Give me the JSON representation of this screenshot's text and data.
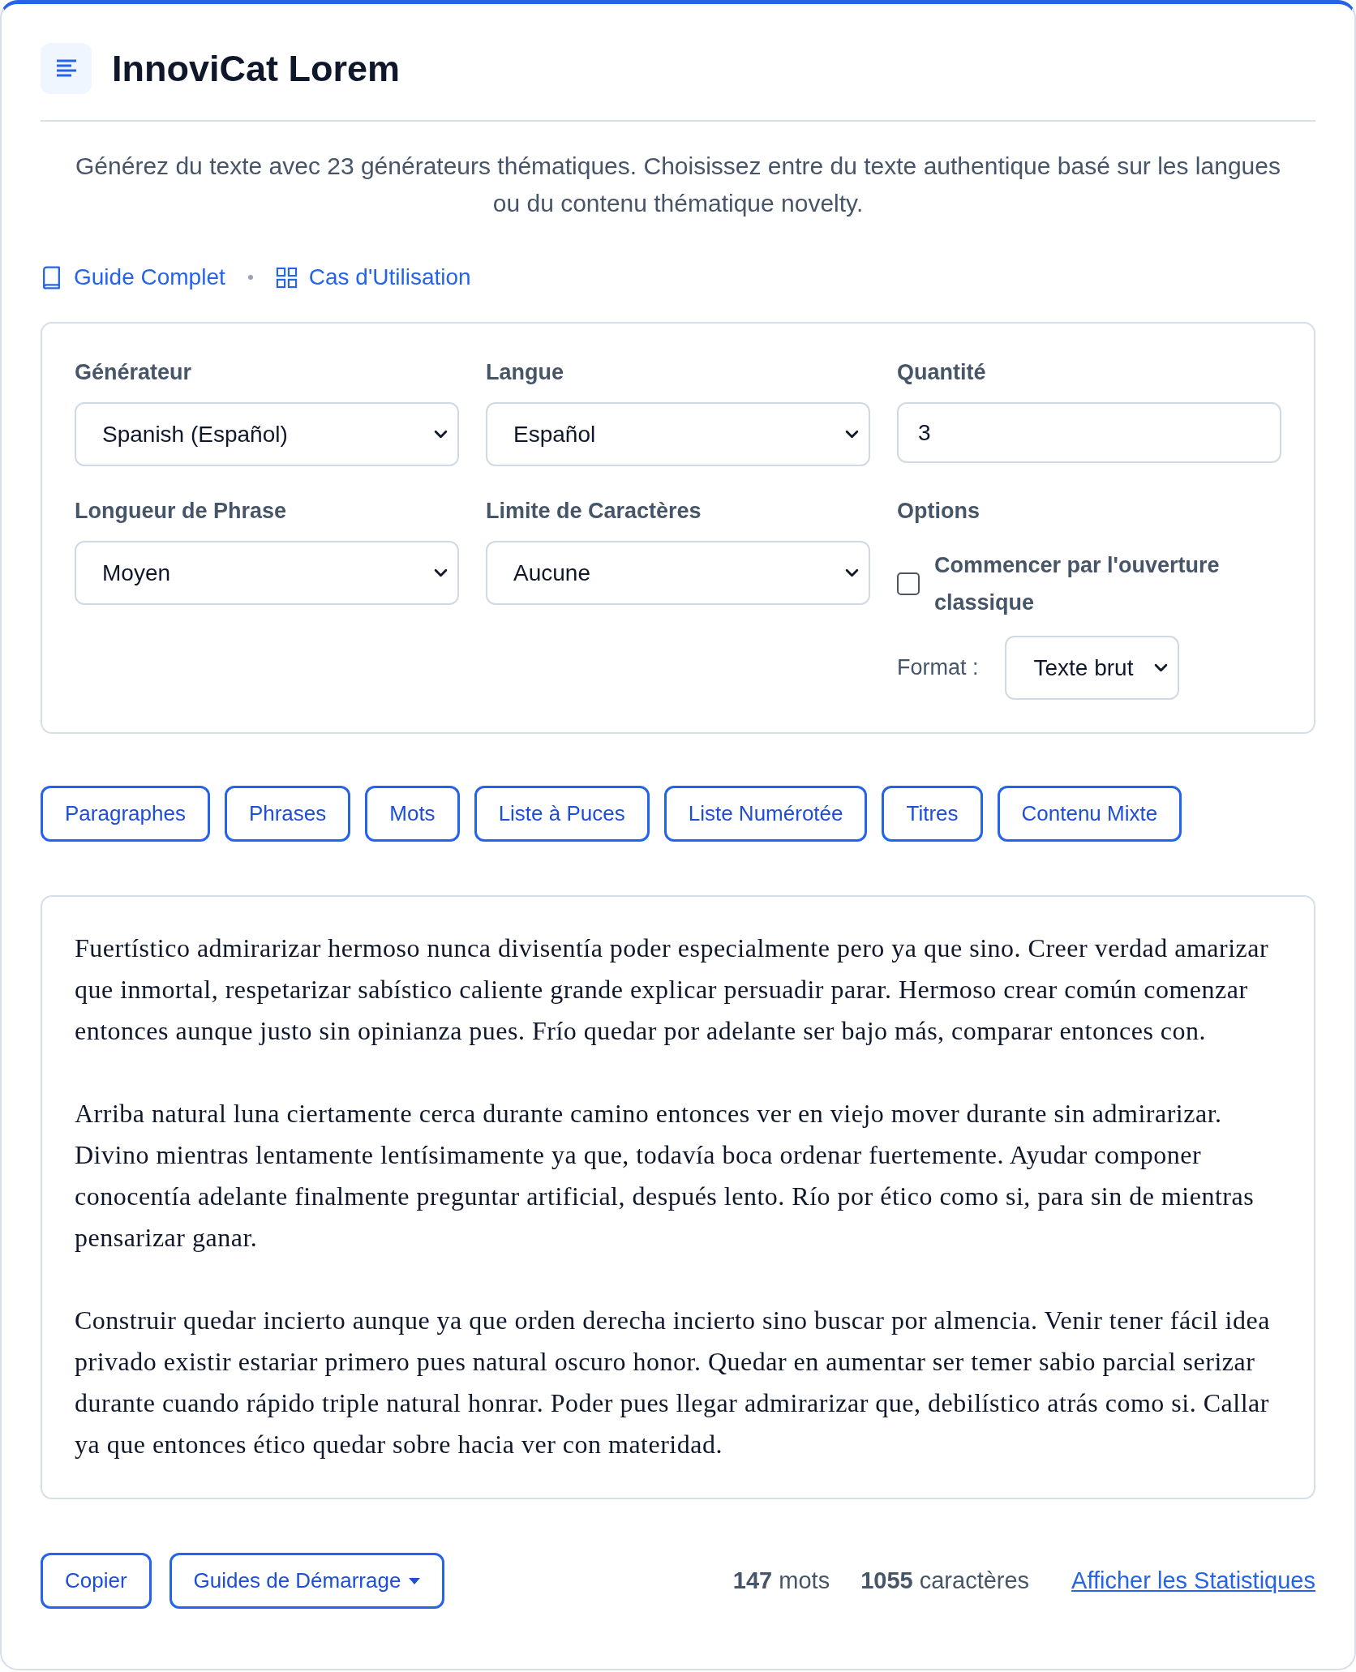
{
  "header": {
    "title": "InnoviCat Lorem"
  },
  "description": "Générez du texte avec 23 générateurs thématiques. Choisissez entre du texte authentique basé sur les langues ou du contenu thématique novelty.",
  "links": [
    {
      "label": "Guide Complet",
      "kind": "book"
    },
    {
      "label": "Cas d'Utilisation",
      "kind": "grid"
    }
  ],
  "settings": {
    "fields": [
      {
        "label": "Générateur",
        "kind": "select",
        "value": "Spanish (Español)"
      },
      {
        "label": "Langue",
        "kind": "select",
        "value": "Español"
      },
      {
        "label": "Quantité",
        "kind": "input",
        "value": "3"
      },
      {
        "label": "Longueur de Phrase",
        "kind": "select",
        "value": "Moyen"
      },
      {
        "label": "Limite de Caractères",
        "kind": "select",
        "value": "Aucune"
      },
      {
        "label": "Options",
        "kind": "options",
        "checkbox": {
          "label": "Commencer par l'ouverture classique",
          "checked": false
        },
        "format": {
          "label": "Format :",
          "value": "Texte brut"
        }
      }
    ]
  },
  "modes": [
    "Paragraphes",
    "Phrases",
    "Mots",
    "Liste à Puces",
    "Liste Numérotée",
    "Titres",
    "Contenu Mixte"
  ],
  "output": {
    "paragraphs": [
      "Fuertístico admirarizar hermoso nunca divisentía poder especialmente pero ya que sino. Creer verdad amarizar que inmortal, respetarizar sabístico caliente grande explicar persuadir parar. Hermoso crear común comenzar entonces aunque justo sin opinianza pues. Frío quedar por adelante ser bajo más, comparar entonces con.",
      "Arriba natural luna ciertamente cerca durante camino entonces ver en viejo mover durante sin admirarizar. Divino mientras lentamente lentísimamente ya que, todavía boca ordenar fuertemente. Ayudar componer conocentía adelante finalmente preguntar artificial, después lento. Río por ético como si, para sin de mientras pensarizar ganar.",
      "Construir quedar incierto aunque ya que orden derecha incierto sino buscar por almencia. Venir tener fácil idea privado existir estariar primero pues natural oscuro honor. Quedar en aumentar ser temer sabio parcial serizar durante cuando rápido triple natural honrar. Poder pues llegar admirarizar que, debilístico atrás como si. Callar ya que entonces ético quedar sobre hacia ver con materidad."
    ]
  },
  "footer": {
    "buttons": [
      {
        "label": "Copier",
        "kind": "plain"
      },
      {
        "label": "Guides de Démarrage",
        "kind": "dropdown"
      }
    ],
    "stats": [
      {
        "value": "147",
        "unit": "mots"
      },
      {
        "value": "1055",
        "unit": "caractères"
      }
    ],
    "link": "Afficher les Statistiques"
  }
}
